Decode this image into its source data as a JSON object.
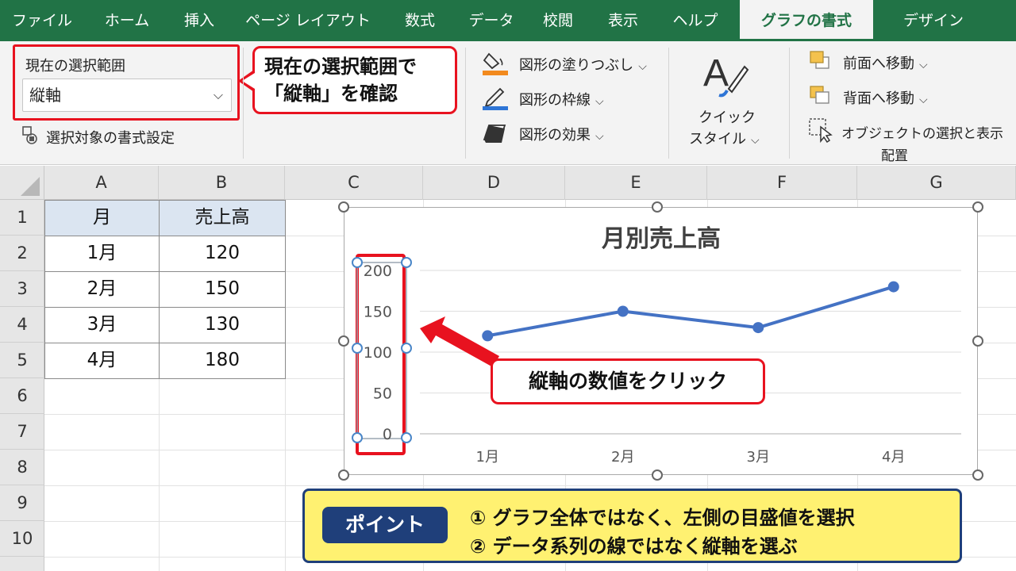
{
  "ribbon_tabs": [
    "ファイル",
    "ホーム",
    "挿入",
    "ページ レイアウト",
    "数式",
    "データ",
    "校閲",
    "表示",
    "ヘルプ",
    "グラフの書式",
    "デザイン"
  ],
  "active_tab": "グラフの書式",
  "selection_group": {
    "label": "現在の選択範囲",
    "selected_value": "縦軸",
    "format_selection": "選択対象の書式設定"
  },
  "callout_selection": {
    "line1": "現在の選択範囲で",
    "line2": "「縦軸」を確認"
  },
  "shape_styles": {
    "fill": "図形の塗りつぶし",
    "outline": "図形の枠線",
    "effects": "図形の効果"
  },
  "quick_styles": {
    "line1": "クイック",
    "line2": "スタイル"
  },
  "arrange": {
    "bring_forward": "前面へ移動",
    "send_backward": "背面へ移動",
    "selection_pane": "オブジェクトの選択と表示",
    "group_label": "配置"
  },
  "sheet": {
    "columns": [
      "A",
      "B",
      "C",
      "D",
      "E",
      "F",
      "G"
    ],
    "rows": [
      "1",
      "2",
      "3",
      "4",
      "5",
      "6",
      "7",
      "8",
      "9",
      "10"
    ],
    "table": {
      "headers": [
        "月",
        "売上高"
      ],
      "rows": [
        [
          "1月",
          "120"
        ],
        [
          "2月",
          "150"
        ],
        [
          "3月",
          "130"
        ],
        [
          "4月",
          "180"
        ]
      ]
    }
  },
  "chart_data": {
    "type": "line",
    "title": "月別売上高",
    "categories": [
      "1月",
      "2月",
      "3月",
      "4月"
    ],
    "series": [
      {
        "values": [
          120,
          150,
          130,
          180
        ],
        "color": "#4472c4"
      }
    ],
    "ylim": [
      0,
      200
    ],
    "yticks": [
      "0",
      "50",
      "100",
      "150",
      "200"
    ],
    "xlabel": "",
    "ylabel": "",
    "grid": true,
    "legend": "none"
  },
  "callout_axis": "縦軸の数値をクリック",
  "point": {
    "label": "ポイント",
    "items": [
      "①  グラフ全体ではなく、左側の目盛値を選択",
      "②  データ系列の線ではなく縦軸を選ぶ"
    ]
  },
  "colors": {
    "ribbon_green": "#217346",
    "highlight_red": "#e8121f",
    "series_blue": "#4472c4",
    "point_navy": "#1f3f7a",
    "point_yellow": "#fff171"
  }
}
